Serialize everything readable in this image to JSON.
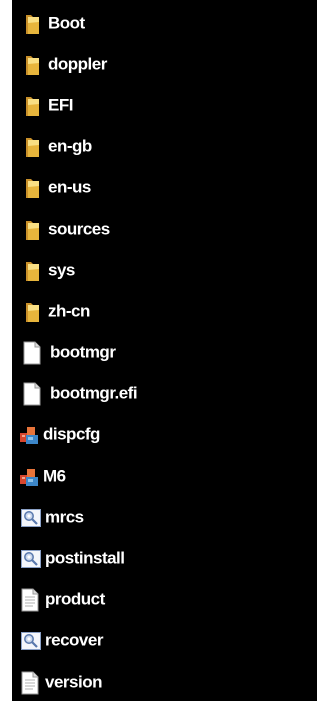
{
  "colors": {
    "background": "#000000",
    "text": "#ffffff",
    "folder": "#e7b53c",
    "folder_light": "#f9df83"
  },
  "items": [
    {
      "name": "Boot",
      "type": "folder",
      "icon": "folder-icon"
    },
    {
      "name": "doppler",
      "type": "folder",
      "icon": "folder-icon"
    },
    {
      "name": "EFI",
      "type": "folder",
      "icon": "folder-icon"
    },
    {
      "name": "en-gb",
      "type": "folder",
      "icon": "folder-icon"
    },
    {
      "name": "en-us",
      "type": "folder",
      "icon": "folder-icon"
    },
    {
      "name": "sources",
      "type": "folder",
      "icon": "folder-icon"
    },
    {
      "name": "sys",
      "type": "folder",
      "icon": "folder-icon"
    },
    {
      "name": "zh-cn",
      "type": "folder",
      "icon": "folder-icon"
    },
    {
      "name": "bootmgr",
      "type": "file",
      "icon": "blank-file-icon"
    },
    {
      "name": "bootmgr.efi",
      "type": "file",
      "icon": "blank-file-icon"
    },
    {
      "name": "dispcfg",
      "type": "application",
      "icon": "application-icon"
    },
    {
      "name": "M6",
      "type": "application",
      "icon": "application-icon"
    },
    {
      "name": "mrcs",
      "type": "setup-information",
      "icon": "setup-info-icon"
    },
    {
      "name": "postinstall",
      "type": "setup-information",
      "icon": "setup-info-icon"
    },
    {
      "name": "product",
      "type": "text-document",
      "icon": "text-document-icon"
    },
    {
      "name": "recover",
      "type": "setup-information",
      "icon": "setup-info-icon"
    },
    {
      "name": "version",
      "type": "text-document",
      "icon": "text-document-icon"
    }
  ]
}
